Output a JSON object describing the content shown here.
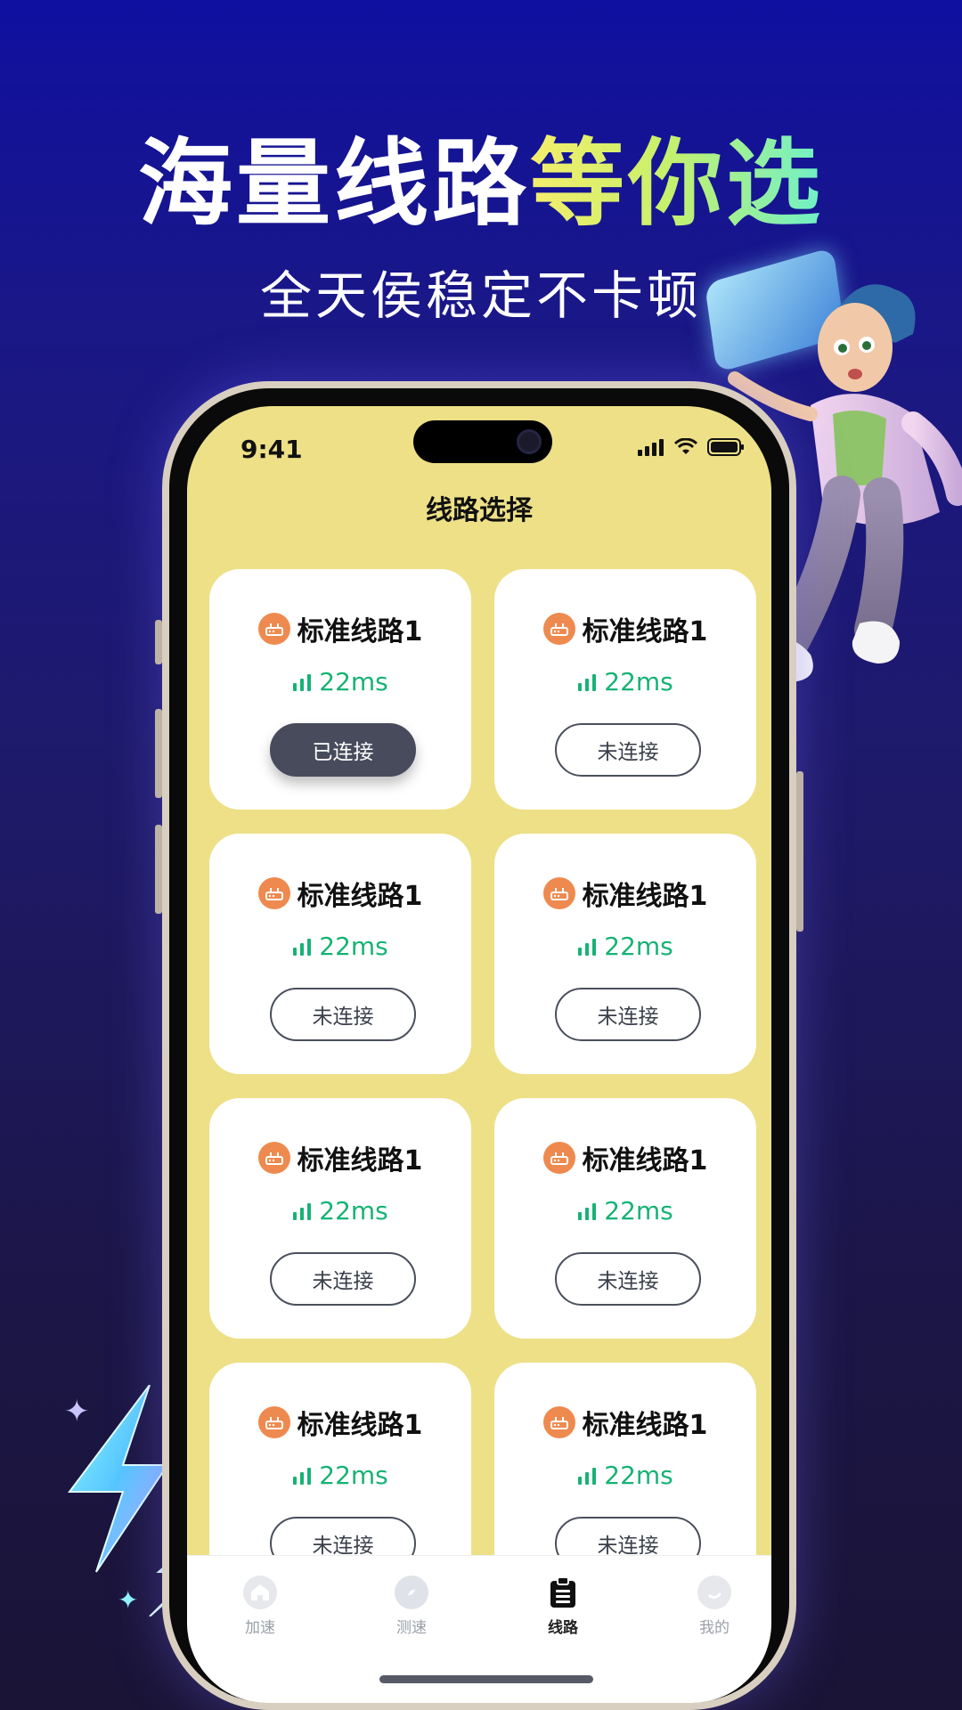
{
  "banner": {
    "headline_white": "海量线路",
    "headline_gradient": "等你选",
    "subhead": "全天侯稳定不卡顿"
  },
  "phone": {
    "status_time": "9:41",
    "screen_title": "线路选择",
    "routes": [
      {
        "name": "标准线路1",
        "latency": "22ms",
        "status": "已连接",
        "connected": true
      },
      {
        "name": "标准线路1",
        "latency": "22ms",
        "status": "未连接",
        "connected": false
      },
      {
        "name": "标准线路1",
        "latency": "22ms",
        "status": "未连接",
        "connected": false
      },
      {
        "name": "标准线路1",
        "latency": "22ms",
        "status": "未连接",
        "connected": false
      },
      {
        "name": "标准线路1",
        "latency": "22ms",
        "status": "未连接",
        "connected": false
      },
      {
        "name": "标准线路1",
        "latency": "22ms",
        "status": "未连接",
        "connected": false
      },
      {
        "name": "标准线路1",
        "latency": "22ms",
        "status": "未连接",
        "connected": false
      },
      {
        "name": "标准线路1",
        "latency": "22ms",
        "status": "未连接",
        "connected": false
      }
    ],
    "tabs": [
      {
        "label": "加速",
        "icon": "home-icon",
        "active": false
      },
      {
        "label": "测速",
        "icon": "compass-icon",
        "active": false
      },
      {
        "label": "线路",
        "icon": "clipboard-icon",
        "active": true
      },
      {
        "label": "我的",
        "icon": "profile-icon",
        "active": false
      }
    ]
  },
  "colors": {
    "background": "#1a1788",
    "screen_background": "#ede087",
    "latency_green": "#16b374",
    "router_orange": "#ee8a4f",
    "connected_button": "#474b5b"
  }
}
